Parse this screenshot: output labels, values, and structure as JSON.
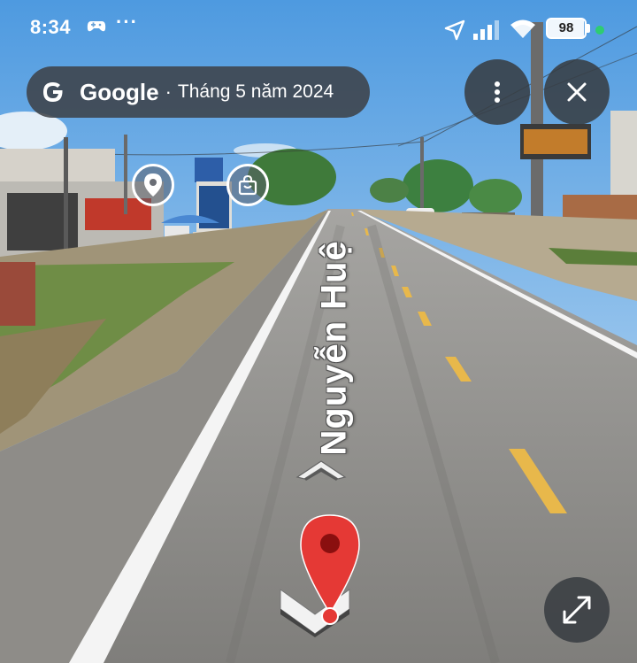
{
  "status_bar": {
    "time": "8:34",
    "more_glyph": "···",
    "battery_level": 98,
    "battery_text": "98",
    "dot_color": "#2ecc71",
    "icons": [
      "gamepad-icon",
      "location-arrow-icon",
      "signal-icon",
      "wifi-icon",
      "battery-icon"
    ]
  },
  "header": {
    "brand": "Google",
    "separator": "·",
    "date": "Tháng 5 năm 2024",
    "logo_icon": "google-g-icon"
  },
  "buttons": {
    "menu_icon": "more-vertical-icon",
    "close_icon": "close-icon",
    "expand_icon": "expand-icon"
  },
  "places": [
    {
      "icon": "location-pin-icon"
    },
    {
      "icon": "shopping-bag-icon"
    }
  ],
  "street": {
    "name": "Nguyễn Huệ"
  },
  "navigation": {
    "forward_icon": "chevron-up-icon",
    "back_icon": "chevron-down-icon",
    "pin_icon": "map-pin-icon",
    "pin_color": "#e53935"
  }
}
